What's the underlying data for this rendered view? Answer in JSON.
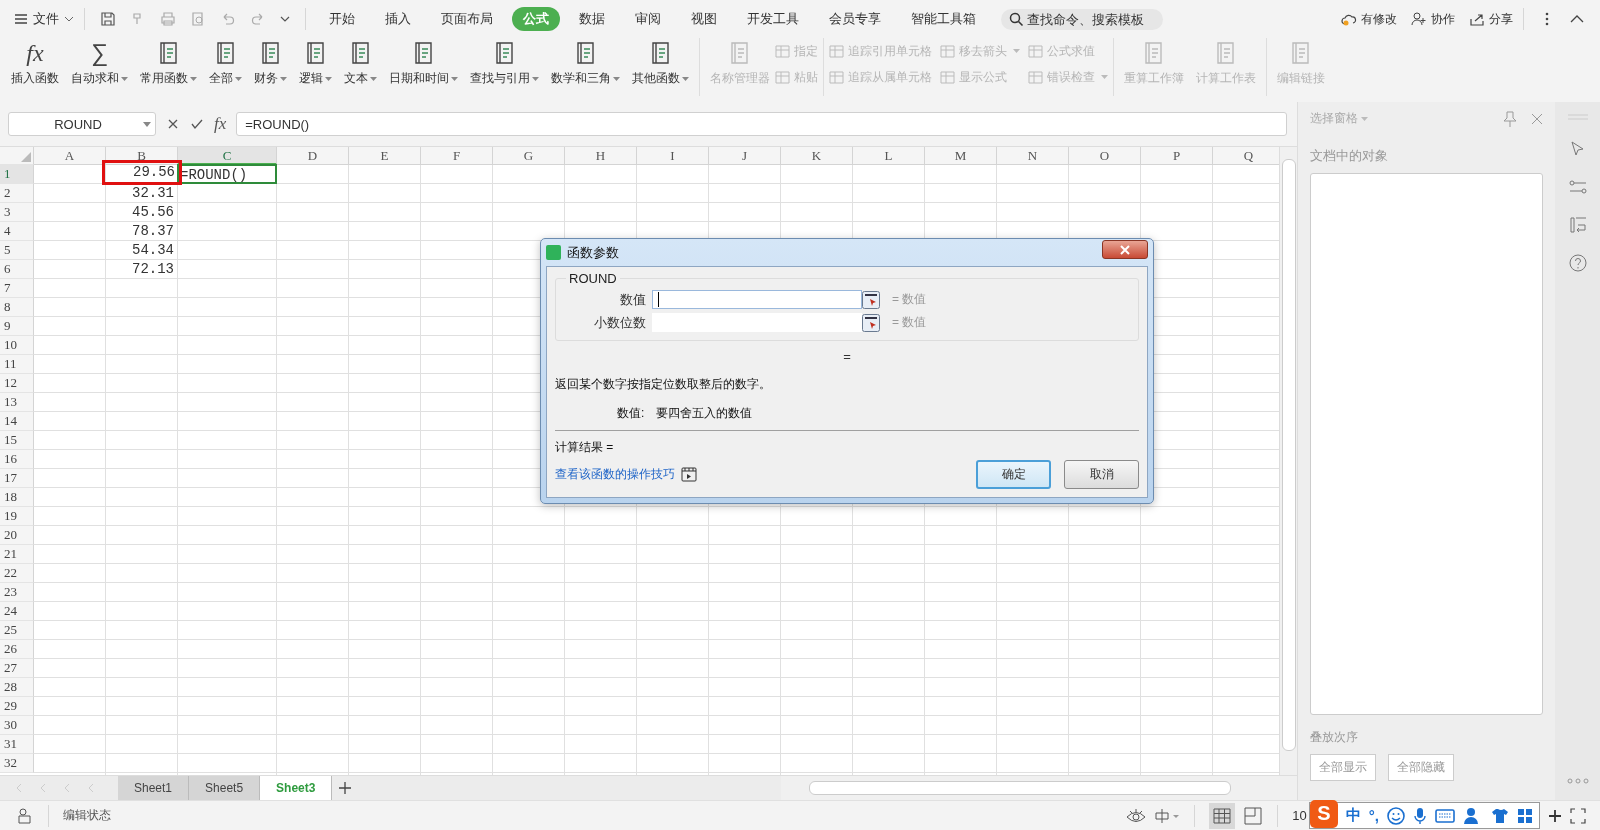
{
  "menu": {
    "label": "文件"
  },
  "menu_tabs": [
    {
      "label": "开始",
      "selected": false
    },
    {
      "label": "插入",
      "selected": false
    },
    {
      "label": "页面布局",
      "selected": false
    },
    {
      "label": "公式",
      "selected": true
    },
    {
      "label": "数据",
      "selected": false
    },
    {
      "label": "审阅",
      "selected": false
    },
    {
      "label": "视图",
      "selected": false
    },
    {
      "label": "开发工具",
      "selected": false
    },
    {
      "label": "会员专享",
      "selected": false
    },
    {
      "label": "智能工具箱",
      "selected": false
    }
  ],
  "search": {
    "placeholder": "查找命令、搜索模板"
  },
  "top_actions": [
    "有修改",
    "协作",
    "分享"
  ],
  "ribbon_groups": [
    {
      "kind": "large",
      "items": [
        {
          "label": "插入函数",
          "glyph": "fx",
          "dropdown": false,
          "disabled": false
        },
        {
          "label": "自动求和",
          "glyph": "∑",
          "dropdown": true,
          "disabled": false
        },
        {
          "label": "常用函数",
          "dropdown": true,
          "disabled": false
        },
        {
          "label": "全部",
          "dropdown": true,
          "disabled": false
        },
        {
          "label": "财务",
          "dropdown": true,
          "disabled": false
        },
        {
          "label": "逻辑",
          "dropdown": true,
          "disabled": false
        },
        {
          "label": "文本",
          "dropdown": true,
          "disabled": false
        },
        {
          "label": "日期和时间",
          "dropdown": true,
          "disabled": false
        },
        {
          "label": "查找与引用",
          "dropdown": true,
          "disabled": false
        },
        {
          "label": "数学和三角",
          "dropdown": true,
          "disabled": false
        },
        {
          "label": "其他函数",
          "dropdown": true,
          "disabled": false
        }
      ]
    },
    {
      "kind": "large",
      "items": [
        {
          "label": "名称管理器",
          "dropdown": false,
          "disabled": true
        }
      ]
    },
    {
      "kind": "stack",
      "items": [
        {
          "label": "指定",
          "dropdown": false,
          "disabled": true
        },
        {
          "label": "粘贴",
          "dropdown": false,
          "disabled": true
        }
      ]
    },
    {
      "kind": "stack",
      "items": [
        {
          "label": "追踪引用单元格",
          "dropdown": false,
          "disabled": true
        },
        {
          "label": "追踪从属单元格",
          "dropdown": false,
          "disabled": true
        },
        {
          "label": "移去箭头",
          "dropdown": true,
          "disabled": true
        },
        {
          "label": "显示公式",
          "dropdown": false,
          "disabled": true
        },
        {
          "label": "公式求值",
          "dropdown": false,
          "disabled": true
        },
        {
          "label": "错误检查",
          "dropdown": true,
          "disabled": true
        }
      ]
    },
    {
      "kind": "large",
      "items": [
        {
          "label": "重算工作簿",
          "dropdown": false,
          "disabled": true
        },
        {
          "label": "计算工作表",
          "dropdown": false,
          "disabled": true
        }
      ]
    },
    {
      "kind": "large",
      "items": [
        {
          "label": "编辑链接",
          "dropdown": false,
          "disabled": true
        }
      ]
    }
  ],
  "formula_bar": {
    "name_box": "ROUND",
    "fx": "fx",
    "formula": "=ROUND()"
  },
  "columns": [
    {
      "label": "A",
      "selected": false
    },
    {
      "label": "B",
      "selected": false
    },
    {
      "label": "C",
      "selected": true
    },
    {
      "label": "D",
      "selected": false
    },
    {
      "label": "E",
      "selected": false
    },
    {
      "label": "F",
      "selected": false
    },
    {
      "label": "G",
      "selected": false
    },
    {
      "label": "H",
      "selected": false
    },
    {
      "label": "I",
      "selected": false
    },
    {
      "label": "J",
      "selected": false
    },
    {
      "label": "K",
      "selected": false
    },
    {
      "label": "L",
      "selected": false
    },
    {
      "label": "M",
      "selected": false
    },
    {
      "label": "N",
      "selected": false
    },
    {
      "label": "O",
      "selected": false
    },
    {
      "label": "P",
      "selected": false
    },
    {
      "label": "Q",
      "selected": false
    }
  ],
  "rows": [
    {
      "number": "1",
      "selected": true,
      "cells": {
        "B": {
          "text": "29.56",
          "highlighted": true,
          "selected": false
        },
        "C": {
          "text": "=ROUND()",
          "highlighted": false,
          "selected": true
        }
      }
    },
    {
      "number": "2",
      "selected": false,
      "cells": {
        "B": {
          "text": "32.31",
          "highlighted": false,
          "selected": false
        }
      }
    },
    {
      "number": "3",
      "selected": false,
      "cells": {
        "B": {
          "text": "45.56",
          "highlighted": false,
          "selected": false
        }
      }
    },
    {
      "number": "4",
      "selected": false,
      "cells": {
        "B": {
          "text": "78.37",
          "highlighted": false,
          "selected": false
        }
      }
    },
    {
      "number": "5",
      "selected": false,
      "cells": {
        "B": {
          "text": "54.34",
          "highlighted": false,
          "selected": false
        }
      }
    },
    {
      "number": "6",
      "selected": false,
      "cells": {
        "B": {
          "text": "72.13",
          "highlighted": false,
          "selected": false
        }
      }
    },
    {
      "number": "7",
      "selected": false
    },
    {
      "number": "8",
      "selected": false
    },
    {
      "number": "9",
      "selected": false
    },
    {
      "number": "10",
      "selected": false
    },
    {
      "number": "11",
      "selected": false
    },
    {
      "number": "12",
      "selected": false
    },
    {
      "number": "13",
      "selected": false
    },
    {
      "number": "14",
      "selected": false
    },
    {
      "number": "15",
      "selected": false
    },
    {
      "number": "16",
      "selected": false
    },
    {
      "number": "17",
      "selected": false
    },
    {
      "number": "18",
      "selected": false
    },
    {
      "number": "19",
      "selected": false
    },
    {
      "number": "20",
      "selected": false
    },
    {
      "number": "21",
      "selected": false
    },
    {
      "number": "22",
      "selected": false
    },
    {
      "number": "23",
      "selected": false
    },
    {
      "number": "24",
      "selected": false
    },
    {
      "number": "25",
      "selected": false
    },
    {
      "number": "26",
      "selected": false
    },
    {
      "number": "27",
      "selected": false
    },
    {
      "number": "28",
      "selected": false
    },
    {
      "number": "29",
      "selected": false
    },
    {
      "number": "30",
      "selected": false
    },
    {
      "number": "31",
      "selected": false
    },
    {
      "number": "32",
      "selected": false
    }
  ],
  "dialog": {
    "title": "函数参数",
    "function_name": "ROUND",
    "arguments": [
      {
        "label": "数值",
        "hint": "= 数值",
        "focused": true
      },
      {
        "label": "小数位数",
        "hint": "= 数值",
        "focused": false
      }
    ],
    "result_sign": "=",
    "description": "返回某个数字按指定位数取整后的数字。",
    "arg_help_label": "数值:",
    "arg_help": "要四舍五入的数值",
    "result_label": "计算结果 =",
    "link": "查看该函数的操作技巧",
    "buttons": [
      {
        "label": "确定",
        "default": true
      },
      {
        "label": "取消",
        "default": false
      }
    ]
  },
  "selection_pane": {
    "title": "选择窗格",
    "heading": "文档中的对象",
    "order_label": "叠放次序",
    "buttons": [
      "全部显示",
      "全部隐藏"
    ]
  },
  "sheet_tabs": [
    {
      "label": "Sheet1",
      "selected": false
    },
    {
      "label": "Sheet5",
      "selected": false
    },
    {
      "label": "Sheet3",
      "selected": true
    }
  ],
  "status_bar": {
    "mode": "编辑状态",
    "zoom": "10"
  },
  "ime_toolbar": {
    "logo": "S",
    "mode": "中",
    "punctuation": "°,"
  }
}
